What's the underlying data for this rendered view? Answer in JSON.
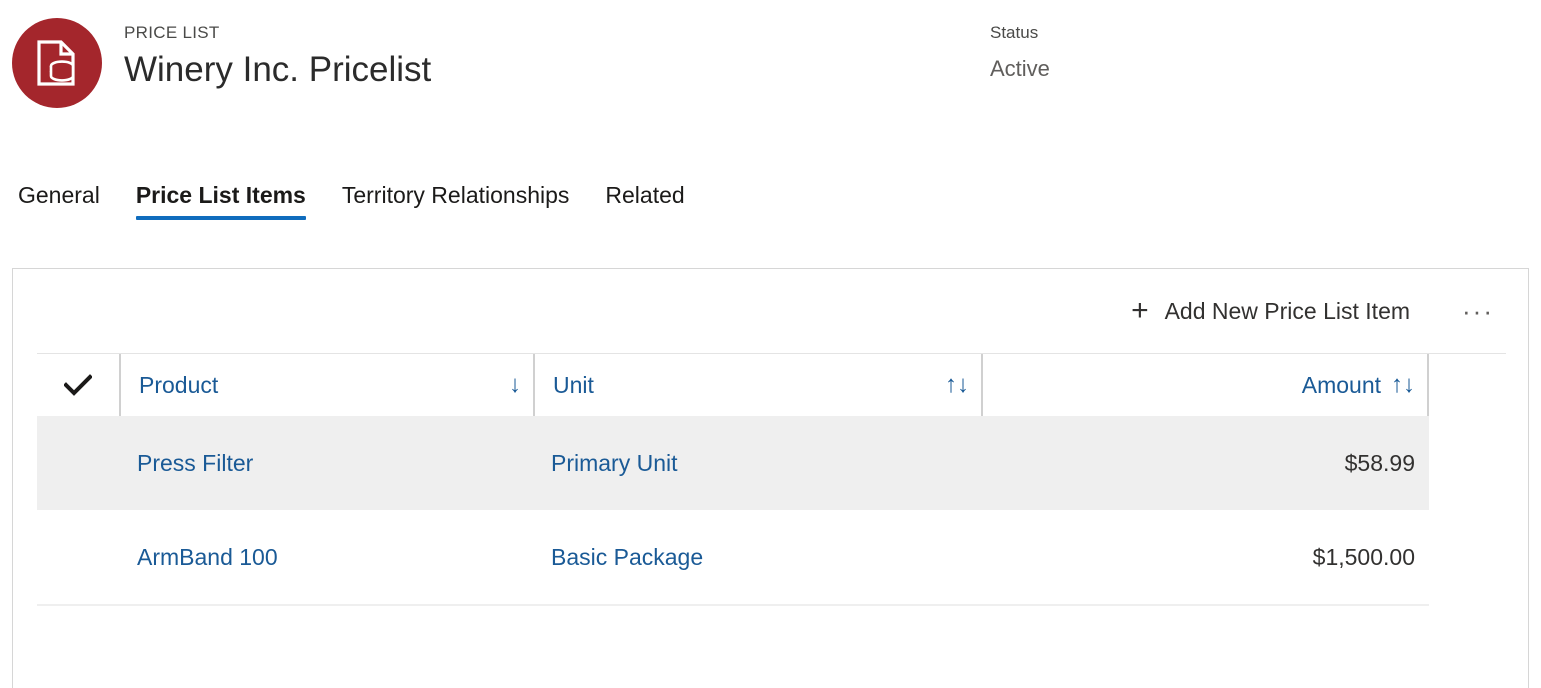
{
  "header": {
    "entity_type": "PRICE LIST",
    "record_title": "Winery Inc. Pricelist",
    "avatar_icon": "price-list-document-coins-icon",
    "avatar_color": "#a4262c",
    "status_label": "Status",
    "status_value": "Active"
  },
  "tabs": [
    {
      "label": "General",
      "active": false
    },
    {
      "label": "Price List Items",
      "active": true
    },
    {
      "label": "Territory Relationships",
      "active": false
    },
    {
      "label": "Related",
      "active": false
    }
  ],
  "command_bar": {
    "add_icon": "plus-icon",
    "add_label": "Add New Price List Item",
    "overflow_label": "···",
    "overflow_icon": "more-ellipsis-icon"
  },
  "grid": {
    "select_all_icon": "checkmark-icon",
    "link_color": "#1a5a96",
    "selected_row_color": "#efefef",
    "columns": [
      {
        "label": "Product",
        "sort_icon": "↓",
        "sort_state": "descending",
        "align": "left"
      },
      {
        "label": "Unit",
        "sort_icon": "↑↓",
        "sort_state": "unsorted",
        "align": "left"
      },
      {
        "label": "Amount",
        "sort_icon": "↑↓",
        "sort_state": "unsorted",
        "align": "right"
      }
    ],
    "rows": [
      {
        "product": "Press Filter",
        "unit": "Primary Unit",
        "amount": "$58.99",
        "selected": true
      },
      {
        "product": "ArmBand 100",
        "unit": "Basic Package",
        "amount": "$1,500.00",
        "selected": false
      }
    ]
  }
}
